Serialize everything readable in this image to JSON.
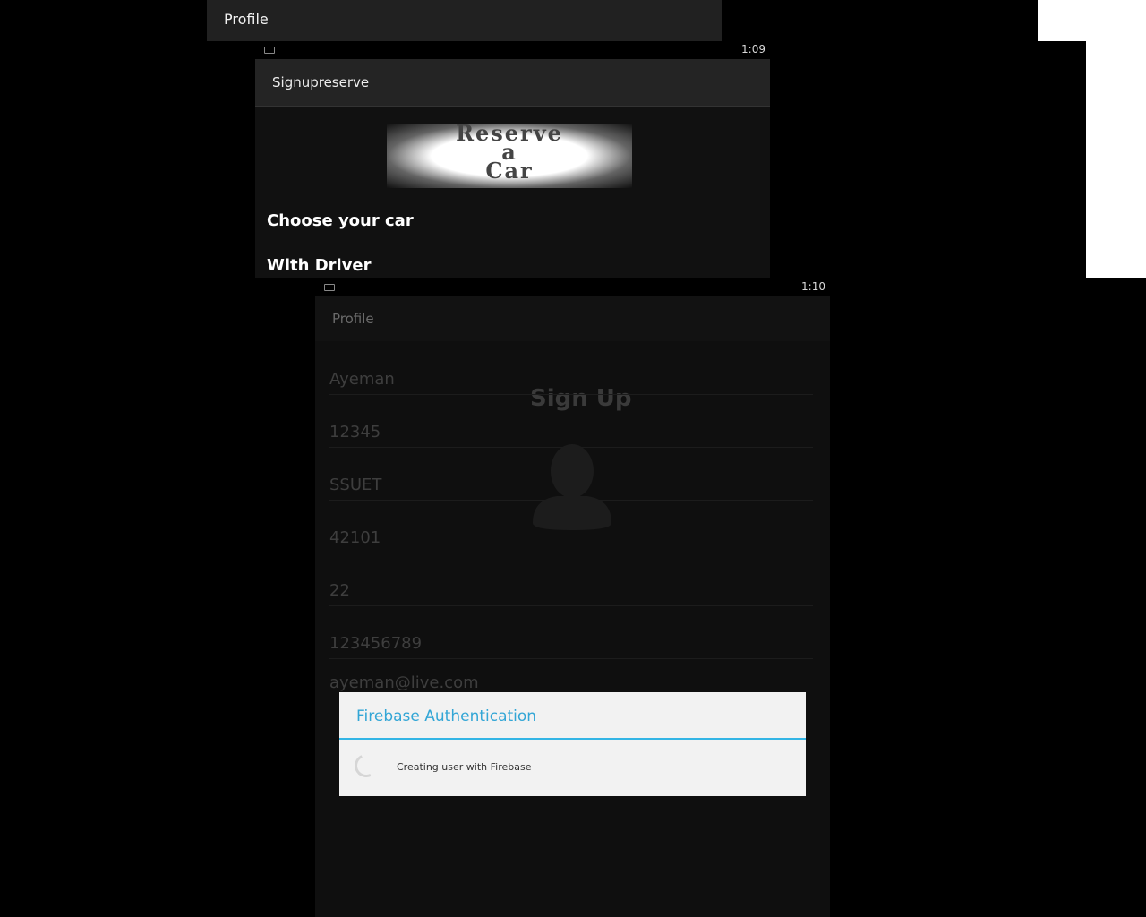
{
  "top_bar": {
    "title": "Profile"
  },
  "window_signupreserve": {
    "status_time": "1:09",
    "title": "Signupreserve",
    "logo_lines": [
      "Reserve",
      "a",
      "Car"
    ],
    "choose_label": "Choose your car",
    "with_driver_label": "With Driver"
  },
  "window_profile": {
    "status_time": "1:10",
    "title": "Profile",
    "signup_title": "Sign Up",
    "fields": {
      "name": "Ayeman",
      "password": "12345",
      "university": "SSUET",
      "code": "42101",
      "age": "22",
      "phone": "123456789",
      "email": "ayeman@live.com"
    }
  },
  "dialog": {
    "title": "Firebase Authentication",
    "message": "Creating user with Firebase"
  },
  "colors": {
    "dialog_accent": "#33b5e5",
    "background": "#000000"
  }
}
